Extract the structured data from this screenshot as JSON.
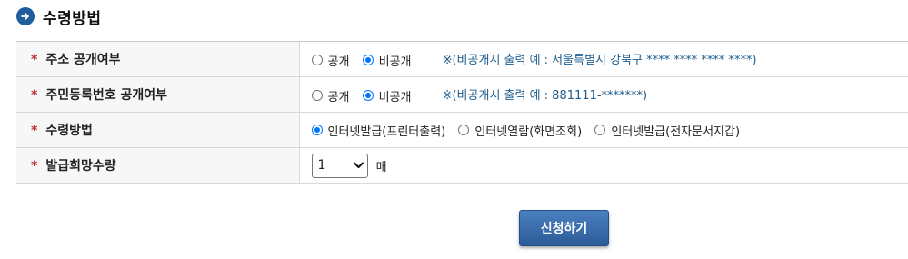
{
  "header": {
    "icon": "arrow-right-circle-icon",
    "title": "수령방법"
  },
  "required_mark": "*",
  "rows": [
    {
      "label": "주소 공개여부",
      "options": [
        "공개",
        "비공개"
      ],
      "selected": "비공개",
      "note": "※(비공개시 출력 예 : 서울특별시 강북구 **** **** **** ****)"
    },
    {
      "label": "주민등록번호 공개여부",
      "options": [
        "공개",
        "비공개"
      ],
      "selected": "비공개",
      "note": "※(비공개시 출력 예 : 881111-*******)"
    },
    {
      "label": "수령방법",
      "options": [
        "인터넷발급(프린터출력)",
        "인터넷열람(화면조회)",
        "인터넷발급(전자문서지갑)"
      ],
      "selected": "인터넷발급(프린터출력)"
    },
    {
      "label": "발급희망수량",
      "quantity": "1",
      "unit": "매"
    }
  ],
  "submit_label": "신청하기",
  "colors": {
    "accent": "#1f5d9c",
    "required": "#c0282e",
    "note": "#1e5d8e",
    "radio_checked": "#0075ff"
  }
}
